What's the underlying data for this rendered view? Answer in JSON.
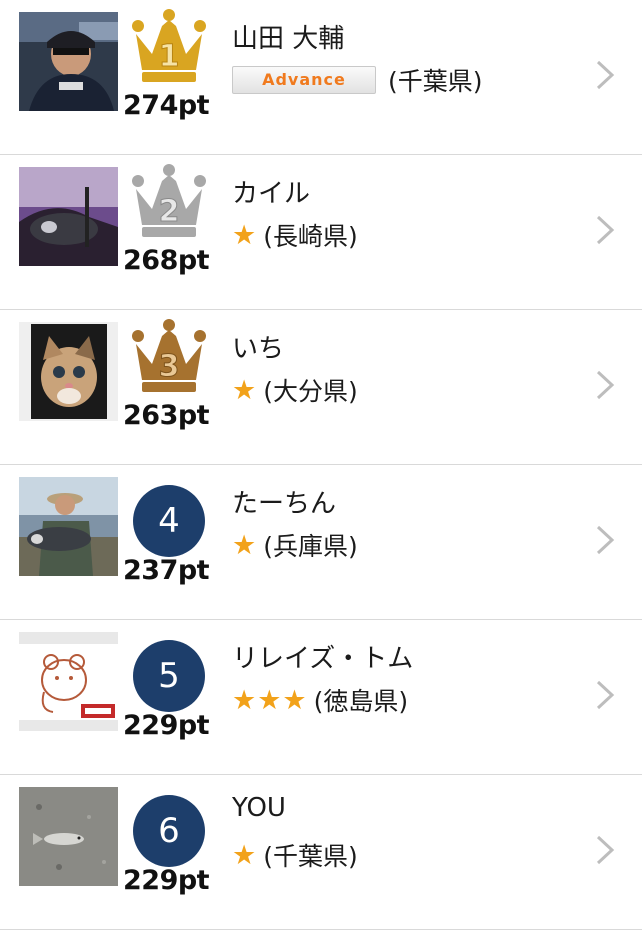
{
  "users": [
    {
      "rank": "1",
      "points": "274pt",
      "name": "山田 大輔",
      "tag": "Advance",
      "stars": "",
      "prefecture": "(千葉県)",
      "badge_type": "crown-gold",
      "avatar": "man-with-cap"
    },
    {
      "rank": "2",
      "points": "268pt",
      "name": "カイル",
      "tag": "",
      "stars": "★",
      "prefecture": "(長崎県)",
      "badge_type": "crown-silver",
      "avatar": "fish-catch-purple"
    },
    {
      "rank": "3",
      "points": "263pt",
      "name": "いち",
      "tag": "",
      "stars": "★",
      "prefecture": "(大分県)",
      "badge_type": "crown-bronze",
      "avatar": "kitten"
    },
    {
      "rank": "4",
      "points": "237pt",
      "name": "たーちん",
      "tag": "",
      "stars": "★",
      "prefecture": "(兵庫県)",
      "badge_type": "circle",
      "avatar": "angler-with-fish"
    },
    {
      "rank": "5",
      "points": "229pt",
      "name": "リレイズ・トム",
      "tag": "",
      "stars": "★★★",
      "prefecture": "(徳島県)",
      "badge_type": "circle",
      "avatar": "bear-logo"
    },
    {
      "rank": "6",
      "points": "229pt",
      "name": "YOU",
      "tag": "",
      "stars": "★",
      "prefecture": "(千葉県)",
      "badge_type": "circle",
      "avatar": "fish-on-ground"
    }
  ],
  "colors": {
    "gold": "#d9a521",
    "silver": "#a8a8a8",
    "bronze": "#a6722f",
    "rank_circle": "#1d3e6b",
    "star": "#f2a21a",
    "advance_text": "#f07a1e"
  }
}
